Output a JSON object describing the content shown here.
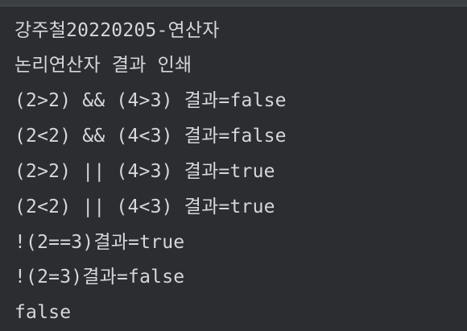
{
  "console": {
    "lines": [
      "강주철20220205-연산자",
      "논리연산자 결과 인쇄",
      "(2>2) && (4>3) 결과=false",
      "(2<2) && (4<3) 결과=false",
      "(2>2) || (4>3) 결과=true",
      "(2<2) || (4<3) 결과=true",
      "!(2==3)결과=true",
      "!(2=3)결과=false",
      "false"
    ]
  },
  "colors": {
    "background": "#2b2d30",
    "text": "#d4d7dc"
  }
}
